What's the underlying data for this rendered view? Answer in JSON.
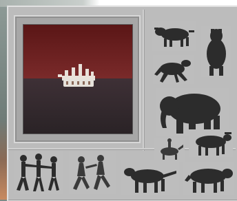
{
  "window": {
    "background_color": "#7d8a86",
    "panel_color": "#bcbcbc"
  },
  "preview": {
    "icon": "bearded-bull-crown-image",
    "sky_color": "#6b1e1e",
    "ground_color": "#3a2a2d",
    "figure_color": "#f0ece4"
  },
  "gallery": {
    "thumbnails": [
      {
        "icon": "bull-silhouette-icon"
      },
      {
        "icon": "standing-horse-silhouette-icon"
      },
      {
        "icon": "galloping-horse-silhouette-icon"
      },
      {
        "icon": "mammoth-silhouette-icon"
      },
      {
        "icon": "dancing-figures-icon"
      },
      {
        "icon": "rider-silhouette-icon"
      },
      {
        "icon": "ox-silhouette-icon"
      },
      {
        "icon": "running-figures-icon"
      },
      {
        "icon": "hunters-icon"
      },
      {
        "icon": "black-horse-silhouette-icon"
      },
      {
        "icon": "bison-silhouette-icon"
      }
    ],
    "silhouette_color": "#2c2c2c"
  }
}
